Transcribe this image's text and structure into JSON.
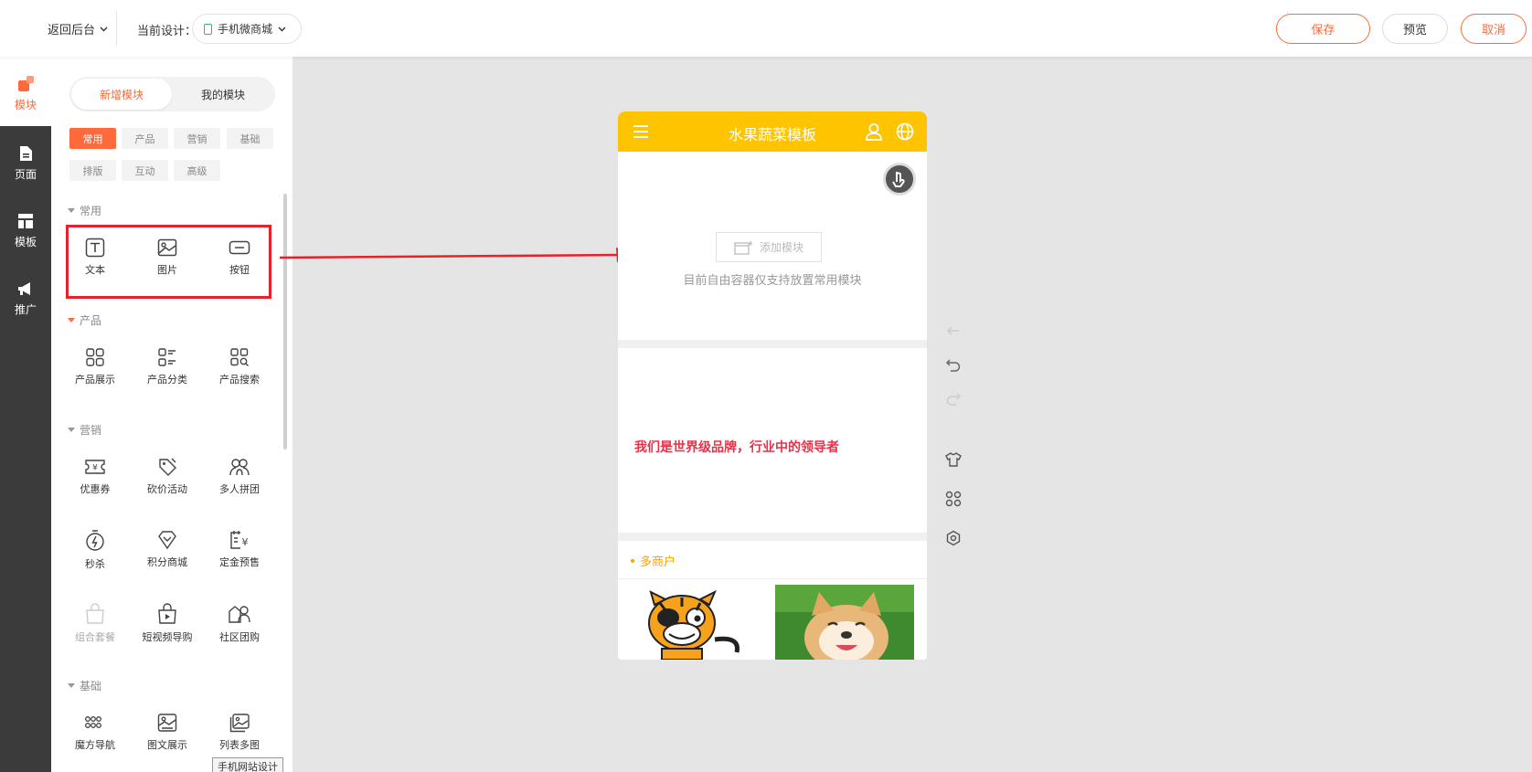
{
  "topbar": {
    "back_label": "返回后台",
    "design_label": "当前设计：",
    "design_value": "手机微商城",
    "save_label": "保存",
    "preview_label": "预览",
    "cancel_label": "取消"
  },
  "leftnav": [
    {
      "label": "模块",
      "icon": "module-icon",
      "active": true
    },
    {
      "label": "页面",
      "icon": "page-icon"
    },
    {
      "label": "模板",
      "icon": "template-icon"
    },
    {
      "label": "推广",
      "icon": "megaphone-icon"
    }
  ],
  "panel": {
    "tabs": [
      "新增模块",
      "我的模块"
    ],
    "chips": [
      "常用",
      "产品",
      "营销",
      "基础",
      "排版",
      "互动",
      "高级"
    ],
    "sections": {
      "common": {
        "title": "常用",
        "items": [
          "文本",
          "图片",
          "按钮"
        ]
      },
      "product": {
        "title": "产品",
        "items": [
          "产品展示",
          "产品分类",
          "产品搜索"
        ]
      },
      "marketing": {
        "title": "营销",
        "items": [
          "优惠券",
          "砍价活动",
          "多人拼团",
          "秒杀",
          "积分商城",
          "定金预售",
          "组合套餐",
          "短视频导购",
          "社区团购"
        ]
      },
      "basic": {
        "title": "基础",
        "items": [
          "魔方导航",
          "图文展示",
          "列表多图"
        ]
      }
    },
    "tooltip": "手机网站设计"
  },
  "phone": {
    "title": "水果蔬菜模板",
    "add_module": "添加模块",
    "hint": "目前自由容器仅支持放置常用模块",
    "slogan": "我们是世界级品牌，行业中的领导者",
    "merchant_title": "多商户"
  },
  "colors": {
    "accent": "#ff6a3c",
    "header": "#ffc400",
    "highlight": "#e3222b",
    "slogan": "#e5334b"
  }
}
